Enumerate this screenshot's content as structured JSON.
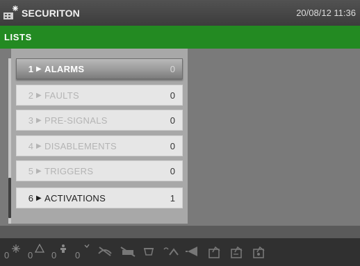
{
  "header": {
    "logo_icon": "securiton-building-icon",
    "app_title": "SECURITON",
    "datetime": "20/08/12 11:36"
  },
  "section": {
    "title": "LISTS"
  },
  "list": {
    "items": [
      {
        "num": "1",
        "label": "ALARMS",
        "count": "0",
        "state": "selected"
      },
      {
        "num": "2",
        "label": "FAULTS",
        "count": "0",
        "state": "inactive"
      },
      {
        "num": "3",
        "label": "PRE-SIGNALS",
        "count": "0",
        "state": "inactive"
      },
      {
        "num": "4",
        "label": "DISABLEMENTS",
        "count": "0",
        "state": "inactive"
      },
      {
        "num": "5",
        "label": "TRIGGERS",
        "count": "0",
        "state": "inactive"
      },
      {
        "num": "6",
        "label": "ACTIVATIONS",
        "count": "1",
        "state": "active"
      }
    ],
    "arrow_icon": "triangle-right-icon"
  },
  "status_icons": [
    {
      "count": "0",
      "icon": "fire-alarm-icon"
    },
    {
      "count": "0",
      "icon": "fault-warning-icon"
    },
    {
      "count": "0",
      "icon": "presignal-icon"
    },
    {
      "count": "0",
      "icon": "disablement-icon"
    }
  ],
  "tool_icons": [
    "sounder-off-icon",
    "buzzer-off-icon",
    "reset-icon",
    "evacuate-icon",
    "horn-icon",
    "document-check-1-icon",
    "document-check-2-icon",
    "document-check-3-icon"
  ],
  "colors": {
    "header": "#3c3c3c",
    "section_bar": "#238a22",
    "panel": "#a8a8a8",
    "row_bg": "#e6e6e6"
  }
}
